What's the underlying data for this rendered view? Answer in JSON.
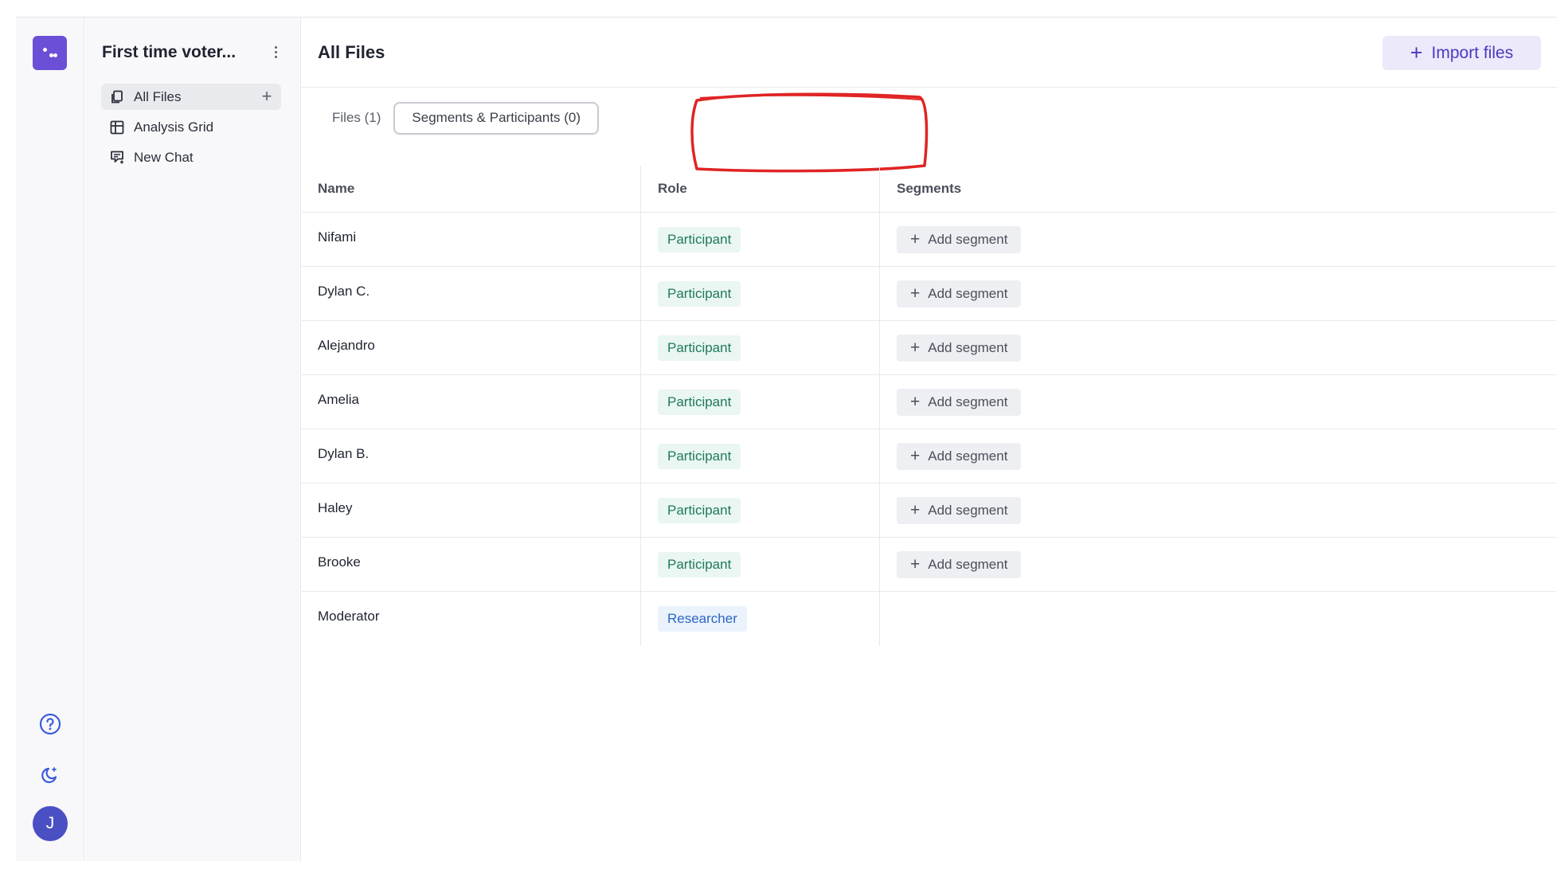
{
  "sidebar": {
    "project_title": "First time voter...",
    "items": [
      {
        "label": "All Files",
        "icon": "files-icon",
        "active": true
      },
      {
        "label": "Analysis Grid",
        "icon": "grid-icon",
        "active": false
      },
      {
        "label": "New Chat",
        "icon": "chat-icon",
        "active": false
      }
    ]
  },
  "rail": {
    "avatar_initial": "J",
    "icons": [
      "logo-icon",
      "help-icon",
      "dark-mode-icon"
    ]
  },
  "header": {
    "title": "All Files",
    "import_label": "Import files"
  },
  "tabs": {
    "files": "Files (1)",
    "segments": "Segments & Participants (0)"
  },
  "table": {
    "headers": {
      "name": "Name",
      "role": "Role",
      "segments": "Segments"
    },
    "add_segment_label": "Add segment",
    "rows": [
      {
        "name": "Nifami",
        "role": "Participant"
      },
      {
        "name": "Dylan C.",
        "role": "Participant"
      },
      {
        "name": "Alejandro",
        "role": "Participant"
      },
      {
        "name": "Amelia",
        "role": "Participant"
      },
      {
        "name": "Dylan B.",
        "role": "Participant"
      },
      {
        "name": "Haley",
        "role": "Participant"
      },
      {
        "name": "Brooke",
        "role": "Participant"
      },
      {
        "name": "Moderator",
        "role": "Researcher"
      }
    ]
  },
  "colors": {
    "brand": "#6b4fd6",
    "participant_text": "#1f7a5c",
    "researcher_text": "#2b66c2",
    "annotation": "#e02424"
  }
}
